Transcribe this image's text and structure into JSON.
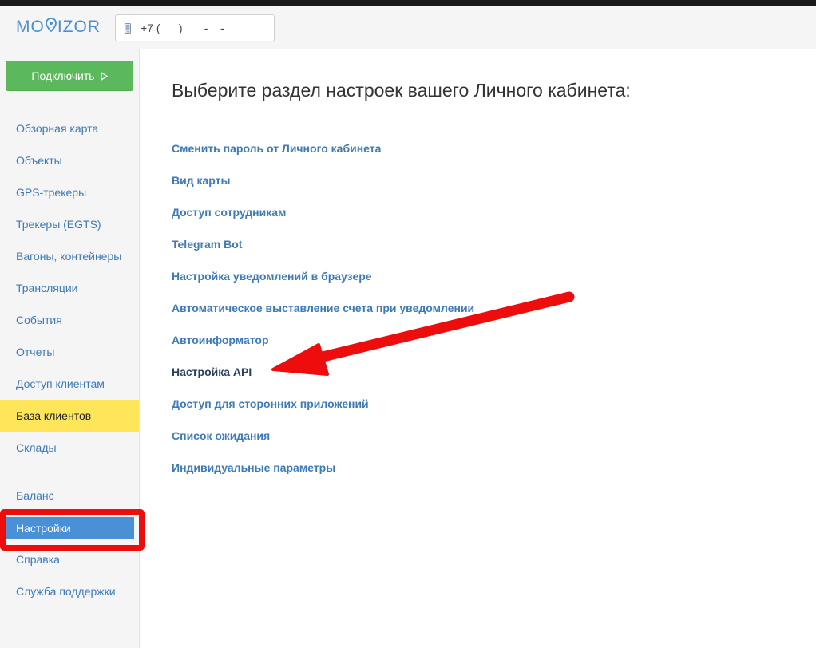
{
  "app": {
    "brand_left": "MO",
    "brand_right": "IZOR",
    "brand_color": "#4a8ed0"
  },
  "header": {
    "phone_value": "+7 (___) ___-__-__"
  },
  "sidebar": {
    "connect_label": "Подключить",
    "items": [
      {
        "label": "Обзорная карта"
      },
      {
        "label": "Объекты"
      },
      {
        "label": "GPS-трекеры"
      },
      {
        "label": "Трекеры (EGTS)"
      },
      {
        "label": "Вагоны, контейнеры"
      },
      {
        "label": "Трансляции"
      },
      {
        "label": "События"
      },
      {
        "label": "Отчеты"
      },
      {
        "label": "Доступ клиентам"
      },
      {
        "label": "База клиентов",
        "state": "highlighted"
      },
      {
        "label": "Склады"
      },
      {
        "label": "Баланс"
      },
      {
        "label": "Настройки",
        "state": "active"
      },
      {
        "label": "Справка"
      },
      {
        "label": "Служба поддержки"
      }
    ]
  },
  "main": {
    "title": "Выберите раздел настроек вашего Личного кабинета:",
    "links": [
      {
        "label": "Сменить пароль от Личного кабинета"
      },
      {
        "label": "Вид карты"
      },
      {
        "label": "Доступ сотрудникам"
      },
      {
        "label": "Telegram Bot"
      },
      {
        "label": "Настройка уведомлений в браузере"
      },
      {
        "label": "Автоматическое выставление счета при уведомлении"
      },
      {
        "label": "Автоинформатор"
      },
      {
        "label": "Настройка API",
        "state": "pointed"
      },
      {
        "label": "Доступ для сторонних приложений"
      },
      {
        "label": "Список ожидания"
      },
      {
        "label": "Индивидуальные параметры"
      }
    ]
  },
  "colors": {
    "accent_green": "#5cb85c",
    "link_blue": "#3d7ab8",
    "active_blue": "#4a90d6",
    "highlight_yellow": "#ffe55a",
    "annotation_red": "#ee0d0d"
  }
}
